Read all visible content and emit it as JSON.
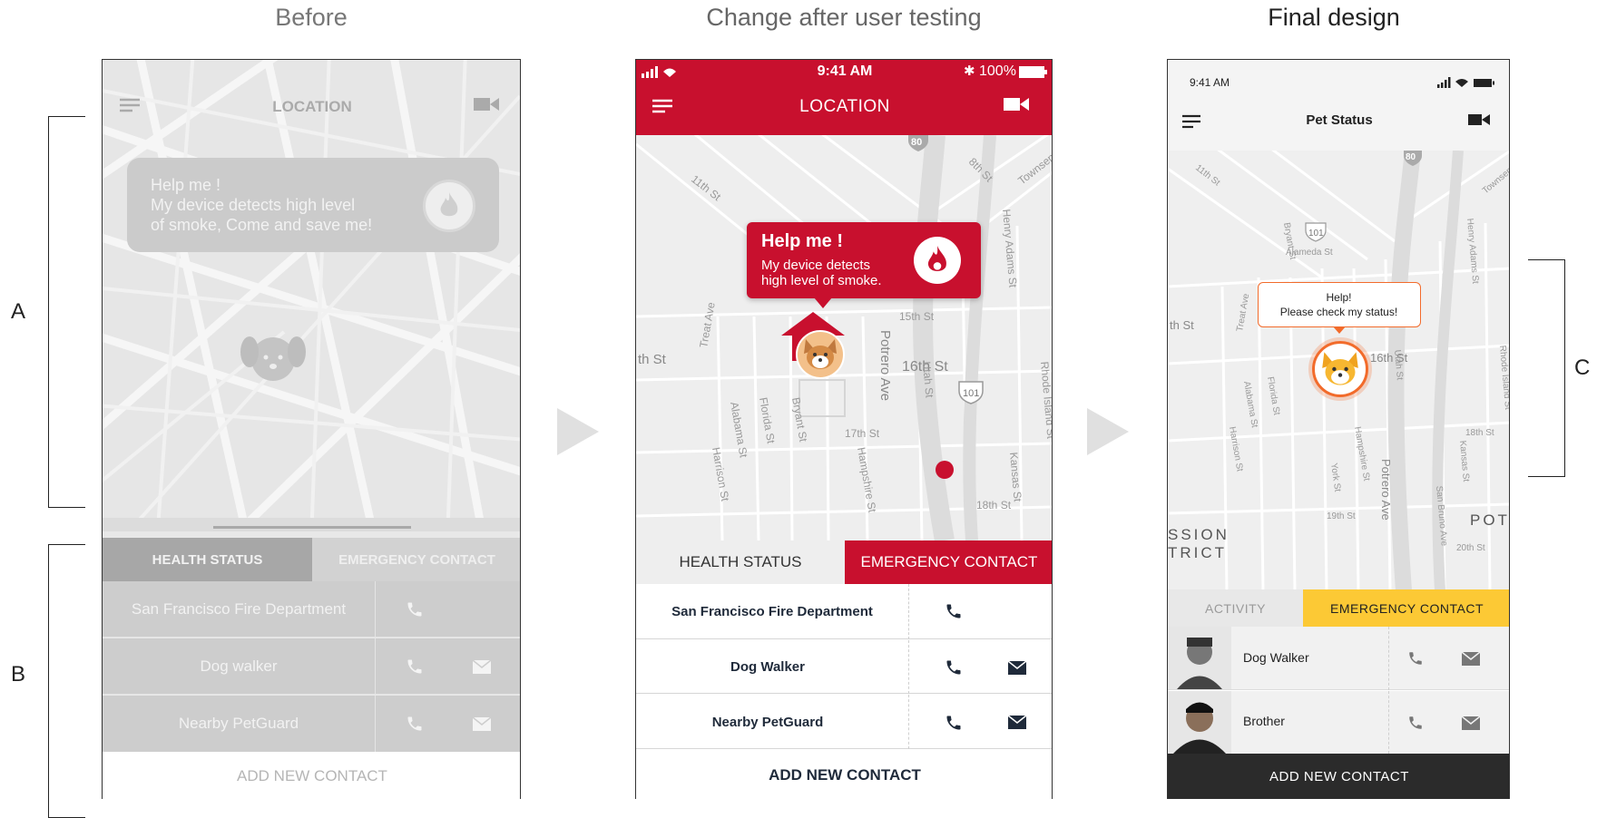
{
  "columns": {
    "before": "Before",
    "change": "Change after user testing",
    "final": "Final design"
  },
  "annotations": {
    "a": "A",
    "b": "B",
    "c": "C"
  },
  "before_screen": {
    "title": "LOCATION",
    "alert_line1": "Help me !",
    "alert_line2": "My device detects high level",
    "alert_line3": "of smoke, Come and save me!",
    "tab_health": "HEALTH STATUS",
    "tab_emergency": "EMERGENCY CONTACT",
    "contacts": [
      "San Francisco Fire Department",
      "Dog walker",
      "Nearby PetGuard"
    ],
    "add_contact": "ADD NEW CONTACT"
  },
  "middle_screen": {
    "status_time": "9:41 AM",
    "status_battery": "100%",
    "title": "LOCATION",
    "alert_title": "Help me !",
    "alert_line1": "My device detects",
    "alert_line2": "high level of smoke.",
    "streets": [
      "11th St",
      "15th St",
      "16th St",
      "17th St",
      "18th St",
      "Potrero Ave",
      "Treat Ave",
      "Alabama St",
      "Florida St",
      "Bryant St",
      "Harrison St",
      "Hampshire St",
      "Utah St",
      "Kansas St",
      "Rhode Island St",
      "Henry Adams St",
      "Townsend",
      "8th St",
      "th St",
      "80",
      "101"
    ],
    "tab_health": "HEALTH STATUS",
    "tab_emergency": "EMERGENCY CONTACT",
    "contacts": [
      "San Francisco Fire Department",
      "Dog Walker",
      "Nearby PetGuard"
    ],
    "add_contact": "ADD NEW CONTACT"
  },
  "final_screen": {
    "status_time": "9:41 AM",
    "title": "Pet Status",
    "bubble_line1": "Help!",
    "bubble_line2": "Please check my status!",
    "streets": [
      "Alameda St",
      "16th St",
      "18th St",
      "19th St",
      "20th St",
      "Potrero Ave",
      "Bryant St",
      "York St",
      "Treat Ave",
      "Alabama St",
      "Florida St",
      "Harrison St",
      "Hampshire St",
      "Utah St",
      "Kansas St",
      "San Bruno Ave",
      "Rhode Island St",
      "Henry Adams St",
      "Townsend",
      "11th St",
      "th St",
      "80",
      "101"
    ],
    "district1": "SSION",
    "district2": "TRICT",
    "district3": "POT",
    "tab_activity": "ACTIVITY",
    "tab_emergency": "EMERGENCY CONTACT",
    "contacts": [
      "Dog Walker",
      "Brother"
    ],
    "add_contact": "ADD NEW CONTACT"
  },
  "colors": {
    "red": "#c8102e",
    "yellow": "#fcc935",
    "orange": "#f26b2b",
    "dark": "#2b2b2b"
  }
}
